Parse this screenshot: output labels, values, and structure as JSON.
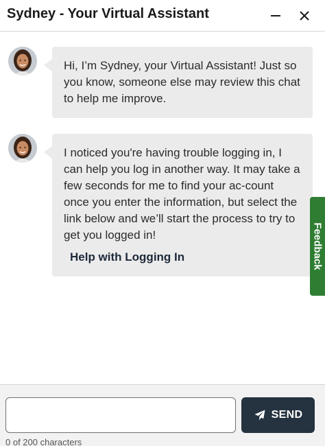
{
  "header": {
    "title": "Sydney - Your Virtual Assistant",
    "minimize_icon": "minus-icon",
    "close_icon": "close-icon"
  },
  "messages": [
    {
      "sender_avatar": "assistant-avatar",
      "text": "Hi, I’m Sydney, your Virtual Assistant! Just so you know, someone else may review this chat to help me improve."
    },
    {
      "sender_avatar": "assistant-avatar",
      "text": "I noticed you're having trouble logging in, I can help you log in another way. It may take a few seconds for me to find your ac-count once you enter the information, but select the link below and we’ll start the process to try to get you logged in!",
      "link_label": "Help with Logging In"
    }
  ],
  "feedback": {
    "label": "Feedback"
  },
  "composer": {
    "input_value": "",
    "send_label": "SEND",
    "send_icon": "paper-plane-icon",
    "char_counter": "0 of 200 characters"
  },
  "colors": {
    "bubble_bg": "#ebebeb",
    "send_button_bg": "#253240",
    "feedback_bg": "#2e7d32",
    "link_text": "#1e2a3a"
  }
}
